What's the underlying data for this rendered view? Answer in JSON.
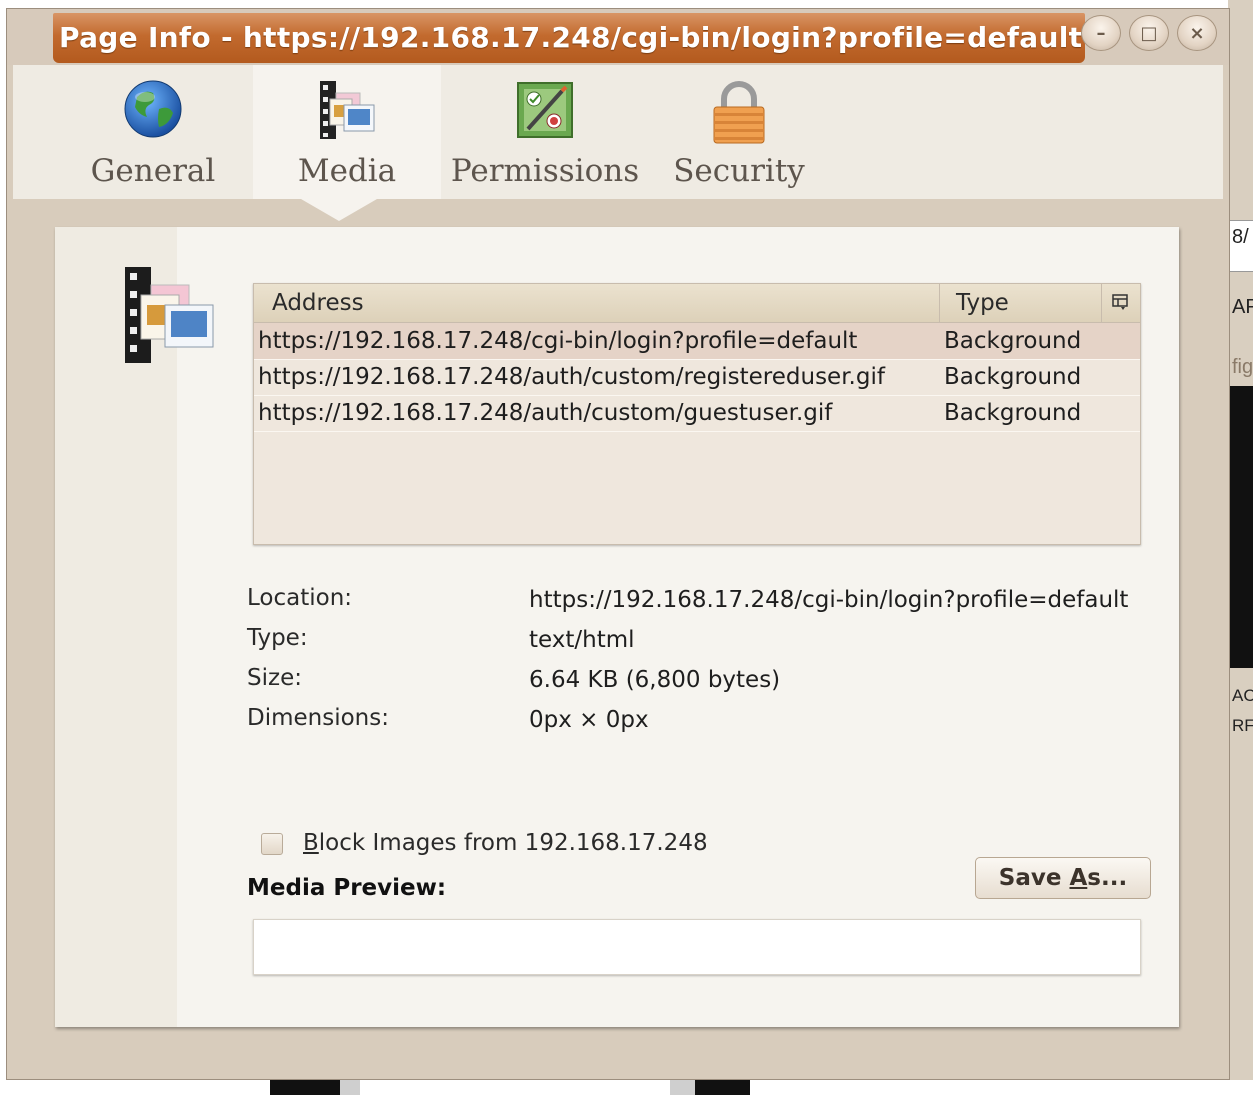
{
  "window": {
    "title": "Page Info - https://192.168.17.248/cgi-bin/login?profile=default",
    "controls": {
      "minimize": "–",
      "maximize": "□",
      "close": "×"
    }
  },
  "tabs": [
    {
      "label": "General",
      "icon": "globe-icon",
      "selected": false
    },
    {
      "label": "Media",
      "icon": "media-icon",
      "selected": true
    },
    {
      "label": "Permissions",
      "icon": "permissions-icon",
      "selected": false
    },
    {
      "label": "Security",
      "icon": "padlock-icon",
      "selected": false
    }
  ],
  "media_table": {
    "columns": {
      "address": "Address",
      "type": "Type",
      "picker_icon": "column-picker-icon"
    },
    "rows": [
      {
        "address": "https://192.168.17.248/cgi-bin/login?profile=default",
        "type": "Background",
        "selected": true
      },
      {
        "address": "https://192.168.17.248/auth/custom/registereduser.gif",
        "type": "Background",
        "selected": false
      },
      {
        "address": "https://192.168.17.248/auth/custom/guestuser.gif",
        "type": "Background",
        "selected": false
      }
    ]
  },
  "properties": {
    "location_label": "Location:",
    "location_value": "https://192.168.17.248/cgi-bin/login?profile=default",
    "type_label": "Type:",
    "type_value": "text/html",
    "size_label": "Size:",
    "size_value": "6.64 KB (6,800 bytes)",
    "dimensions_label": "Dimensions:",
    "dimensions_value": "0px × 0px"
  },
  "block_images": {
    "checked": false,
    "label_accel": "B",
    "label_rest": "lock Images from 192.168.17.248"
  },
  "media_preview": {
    "label": "Media Preview:"
  },
  "save_as": {
    "label_pre": "Save ",
    "label_accel": "A",
    "label_post": "s..."
  },
  "background_fragments": [
    "8/",
    "AP",
    "fig",
    "AC",
    "RF"
  ],
  "colors": {
    "title_accent": "#c26a2e",
    "selected_row": "#e5d3c7",
    "window_bg": "#d8ccbc"
  }
}
